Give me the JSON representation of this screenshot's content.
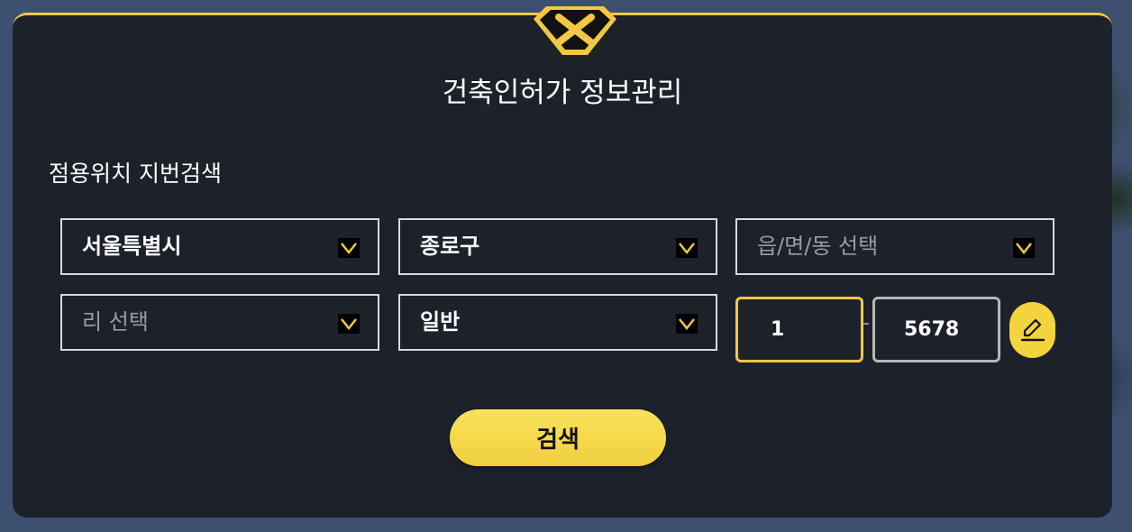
{
  "header": {
    "title": "건축인허가 정보관리"
  },
  "search_section": {
    "title": "점용위치 지번검색",
    "selects": {
      "sido": {
        "value": "서울특별시",
        "is_placeholder": false
      },
      "sigungu": {
        "value": "종로구",
        "is_placeholder": false
      },
      "eupmyeondong": {
        "value": "읍/면/동 선택",
        "is_placeholder": true
      },
      "ri": {
        "value": "리 선택",
        "is_placeholder": true
      },
      "land_type": {
        "value": "일반",
        "is_placeholder": false
      }
    },
    "main_number": {
      "value": "1"
    },
    "separator": "-",
    "sub_number": {
      "value": "5678"
    },
    "search_button_label": "검색"
  },
  "icons": {
    "close": "close-icon",
    "chevron": "chevron-down-icon",
    "edit": "pencil-icon"
  },
  "colors": {
    "accent": "#f2c744",
    "panel": "#1d212a",
    "button": "#f4d43d"
  }
}
